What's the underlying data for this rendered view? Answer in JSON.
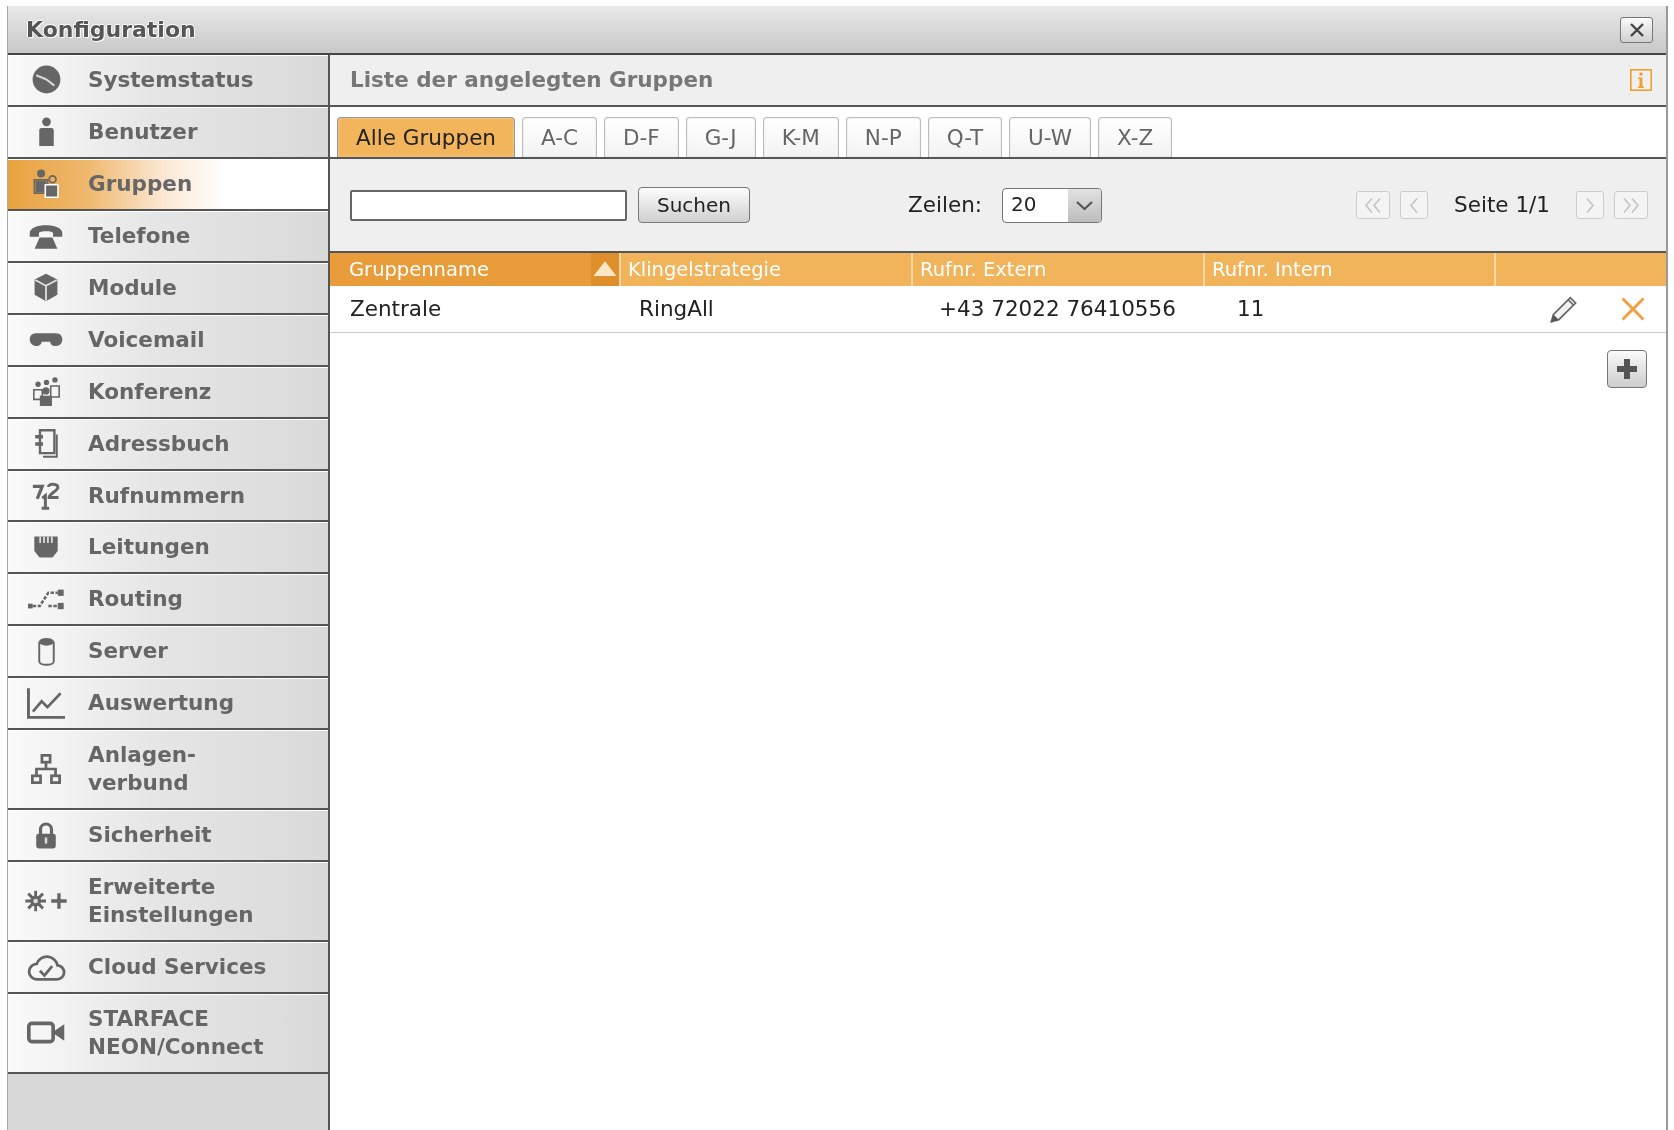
{
  "window": {
    "title": "Konfiguration"
  },
  "sidebar": {
    "items": [
      {
        "label": "Systemstatus",
        "selected": false
      },
      {
        "label": "Benutzer",
        "selected": false
      },
      {
        "label": "Gruppen",
        "selected": true
      },
      {
        "label": "Telefone",
        "selected": false
      },
      {
        "label": "Module",
        "selected": false
      },
      {
        "label": "Voicemail",
        "selected": false
      },
      {
        "label": "Konferenz",
        "selected": false
      },
      {
        "label": "Adressbuch",
        "selected": false
      },
      {
        "label": "Rufnummern",
        "selected": false
      },
      {
        "label": "Leitungen",
        "selected": false
      },
      {
        "label": "Routing",
        "selected": false
      },
      {
        "label": "Server",
        "selected": false
      },
      {
        "label": "Auswertung",
        "selected": false
      },
      {
        "label": "Anlagen-\nverbund",
        "selected": false
      },
      {
        "label": "Sicherheit",
        "selected": false
      },
      {
        "label": "Erweiterte Einstellungen",
        "selected": false
      },
      {
        "label": "Cloud Services",
        "selected": false
      },
      {
        "label": "STARFACE NEON/Connect",
        "selected": false
      }
    ]
  },
  "panel": {
    "title": "Liste der angelegten Gruppen",
    "tabs": [
      {
        "label": "Alle Gruppen",
        "selected": true
      },
      {
        "label": "A-C",
        "selected": false
      },
      {
        "label": "D-F",
        "selected": false
      },
      {
        "label": "G-J",
        "selected": false
      },
      {
        "label": "K-M",
        "selected": false
      },
      {
        "label": "N-P",
        "selected": false
      },
      {
        "label": "Q-T",
        "selected": false
      },
      {
        "label": "U-W",
        "selected": false
      },
      {
        "label": "X-Z",
        "selected": false
      }
    ],
    "toolbar": {
      "search_button": "Suchen",
      "rows_label": "Zeilen:",
      "rows_value": "20",
      "pager": {
        "label": "Seite 1/1",
        "buttons": [
          {
            "kind": "first",
            "disabled": true
          },
          {
            "kind": "previous",
            "disabled": true
          },
          {
            "kind": "next",
            "disabled": true
          },
          {
            "kind": "last",
            "disabled": true
          }
        ]
      }
    },
    "table": {
      "columns": [
        {
          "label": "Gruppenname",
          "sorted": true
        },
        {
          "label": "Klingelstrategie",
          "sorted": false
        },
        {
          "label": "Rufnr. Extern",
          "sorted": false
        },
        {
          "label": "Rufnr. Intern",
          "sorted": false
        }
      ],
      "rows": [
        {
          "cells": [
            "Zentrale",
            "RingAll",
            "+43 72022 76410556",
            "11"
          ]
        }
      ]
    }
  }
}
